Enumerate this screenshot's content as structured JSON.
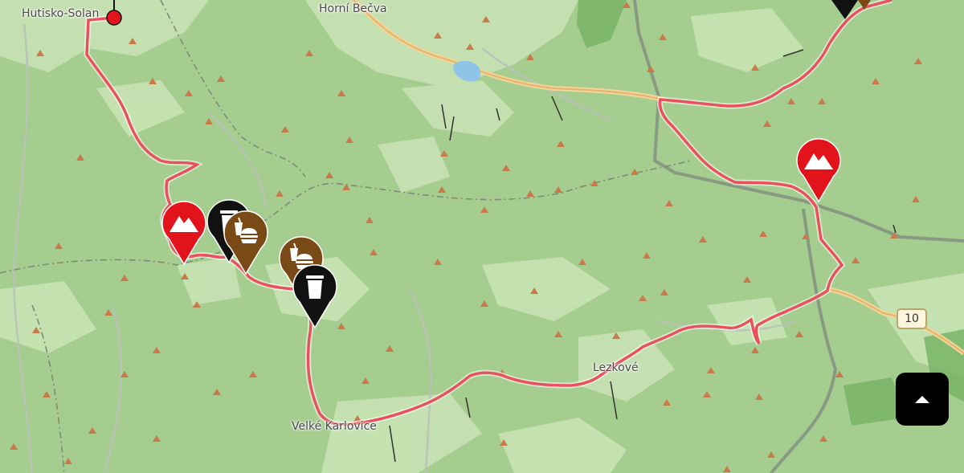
{
  "map": {
    "places": [
      {
        "id": "hutisko",
        "label": "Hutisko-Solan"
      },
      {
        "id": "horni-becva",
        "label": "Horní Bečva"
      },
      {
        "id": "lezkove",
        "label": "Lezkové"
      },
      {
        "id": "velke-karlovice",
        "label": "Velké Karlovice"
      }
    ],
    "road_shield": "10",
    "markers": [
      {
        "name": "peak-marker-west",
        "category": "peak",
        "icon": "mountain-icon",
        "color": "#e3131b"
      },
      {
        "name": "trash-marker-west",
        "category": "waste-bin",
        "icon": "trash-icon",
        "color": "#111111"
      },
      {
        "name": "food-marker-west",
        "category": "restaurant",
        "icon": "food-icon",
        "color": "#7a4a16"
      },
      {
        "name": "food-marker-middle",
        "category": "restaurant",
        "icon": "food-icon",
        "color": "#7a4a16"
      },
      {
        "name": "trash-marker-middle",
        "category": "waste-bin",
        "icon": "trash-icon",
        "color": "#111111"
      },
      {
        "name": "peak-marker-east",
        "category": "peak",
        "icon": "mountain-icon",
        "color": "#e3131b"
      }
    ],
    "route_color": "#e8525a",
    "controls": {
      "scroll_up_icon": "chevron-up-icon"
    }
  }
}
